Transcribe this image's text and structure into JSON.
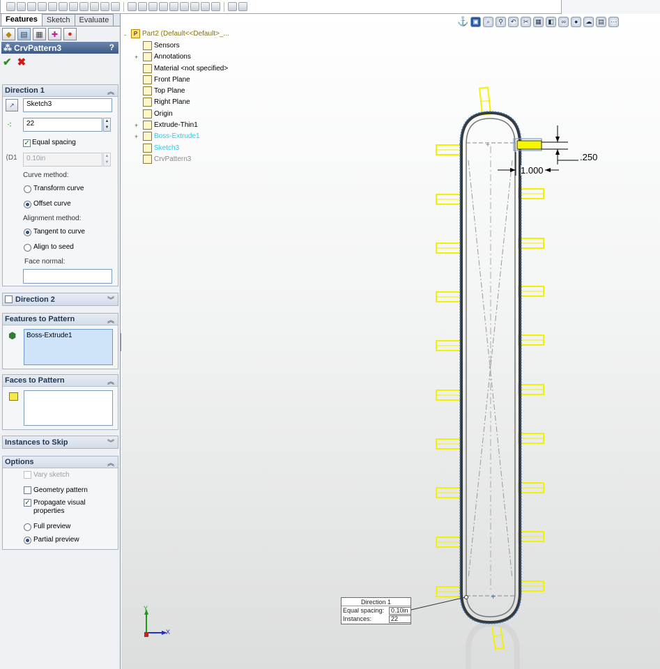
{
  "tabs": [
    {
      "label": "Features",
      "active": true
    },
    {
      "label": "Sketch",
      "active": false
    },
    {
      "label": "Evaluate",
      "active": false
    }
  ],
  "property_manager": {
    "title": "CrvPattern3",
    "help": "?",
    "ok": "✔",
    "cancel": "✖"
  },
  "direction1": {
    "header": "Direction 1",
    "sketch": "Sketch3",
    "instances": "22",
    "equal_spacing_label": "Equal spacing",
    "equal_spacing": true,
    "spacing": "0.10in",
    "curve_method_label": "Curve method:",
    "transform_curve": "Transform curve",
    "offset_curve": "Offset curve",
    "alignment_method_label": "Alignment method:",
    "tangent_to_curve": "Tangent to curve",
    "align_to_seed": "Align to seed",
    "face_normal_label": "Face normal:",
    "face_normal": ""
  },
  "direction2": {
    "header": "Direction 2",
    "enabled": false
  },
  "features_to_pattern": {
    "header": "Features to Pattern",
    "items": [
      "Boss-Extrude1"
    ]
  },
  "faces_to_pattern": {
    "header": "Faces to Pattern"
  },
  "instances_to_skip": {
    "header": "Instances to Skip"
  },
  "options": {
    "header": "Options",
    "vary_sketch": "Vary sketch",
    "geometry_pattern": "Geometry pattern",
    "propagate_line1": "Propagate visual",
    "propagate_line2": "properties",
    "full_preview": "Full preview",
    "partial_preview": "Partial preview"
  },
  "tree": {
    "root": "Part2  (Default<<Default>_...",
    "items": [
      {
        "label": "Sensors",
        "color": "#000000",
        "icon": "sensor-icon"
      },
      {
        "label": "Annotations",
        "color": "#000000",
        "icon": "annotations-icon"
      },
      {
        "label": "Material <not specified>",
        "color": "#000000",
        "icon": "material-icon"
      },
      {
        "label": "Front Plane",
        "color": "#000000",
        "icon": "plane-icon"
      },
      {
        "label": "Top Plane",
        "color": "#000000",
        "icon": "plane-icon"
      },
      {
        "label": "Right Plane",
        "color": "#000000",
        "icon": "plane-icon"
      },
      {
        "label": "Origin",
        "color": "#000000",
        "icon": "origin-icon"
      },
      {
        "label": "Extrude-Thin1",
        "color": "#000000",
        "icon": "extrude-icon"
      },
      {
        "label": "Boss-Extrude1",
        "color": "#33c8e8",
        "icon": "extrude-icon"
      },
      {
        "label": "Sketch3",
        "color": "#33c8e8",
        "icon": "sketch-icon"
      },
      {
        "label": "CrvPattern3",
        "color": "#8a8a8a",
        "icon": "curve-pattern-icon"
      }
    ]
  },
  "dimensions": {
    "height": ".250",
    "width": "1.000"
  },
  "callout": {
    "title": "Direction 1",
    "spacing_label": "Equal spacing:",
    "spacing_value": "0.10in",
    "instances_label": "Instances:",
    "instances_value": "22"
  },
  "triad": {
    "x": "X",
    "y": "Y"
  },
  "colors": {
    "preview": "#f2f200",
    "selection": "#3a7fd5",
    "tree_highlight": "#33c8e8"
  }
}
